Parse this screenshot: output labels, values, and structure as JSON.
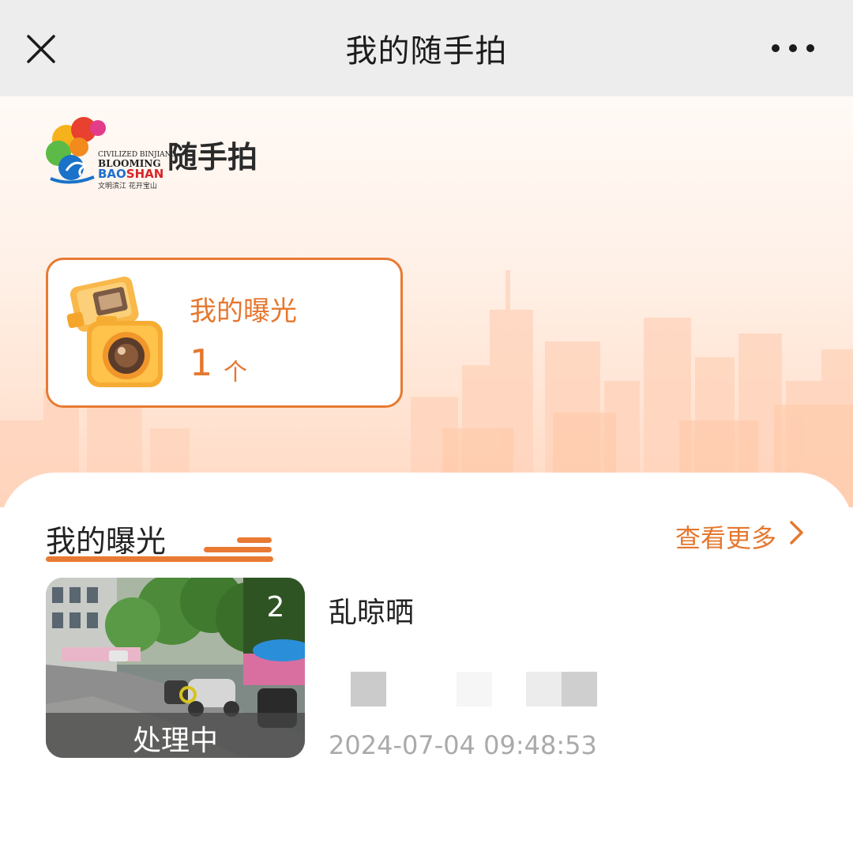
{
  "titlebar": {
    "title": "我的随手拍",
    "close_icon": "close-icon",
    "more_icon": "more-dots-icon"
  },
  "brand": {
    "name": "随手拍",
    "line1": "CIVILIZED BINJIANG",
    "line2": "BLOOMING",
    "line3_part1": "BAO",
    "line3_part2": "SHAN",
    "tagline": "文明滨江 花开宝山"
  },
  "summary_card": {
    "label": "我的曝光",
    "count": "1",
    "unit": "个"
  },
  "section": {
    "title": "我的曝光",
    "view_more": "查看更多"
  },
  "items": [
    {
      "photo_count": "2",
      "status": "处理中",
      "title": "乱晾晒",
      "timestamp": "2024-07-04 09:48:53"
    }
  ],
  "colors": {
    "accent": "#e5782f",
    "titlebar_bg": "#ededed",
    "hero_bg": "#ffe4d3"
  }
}
